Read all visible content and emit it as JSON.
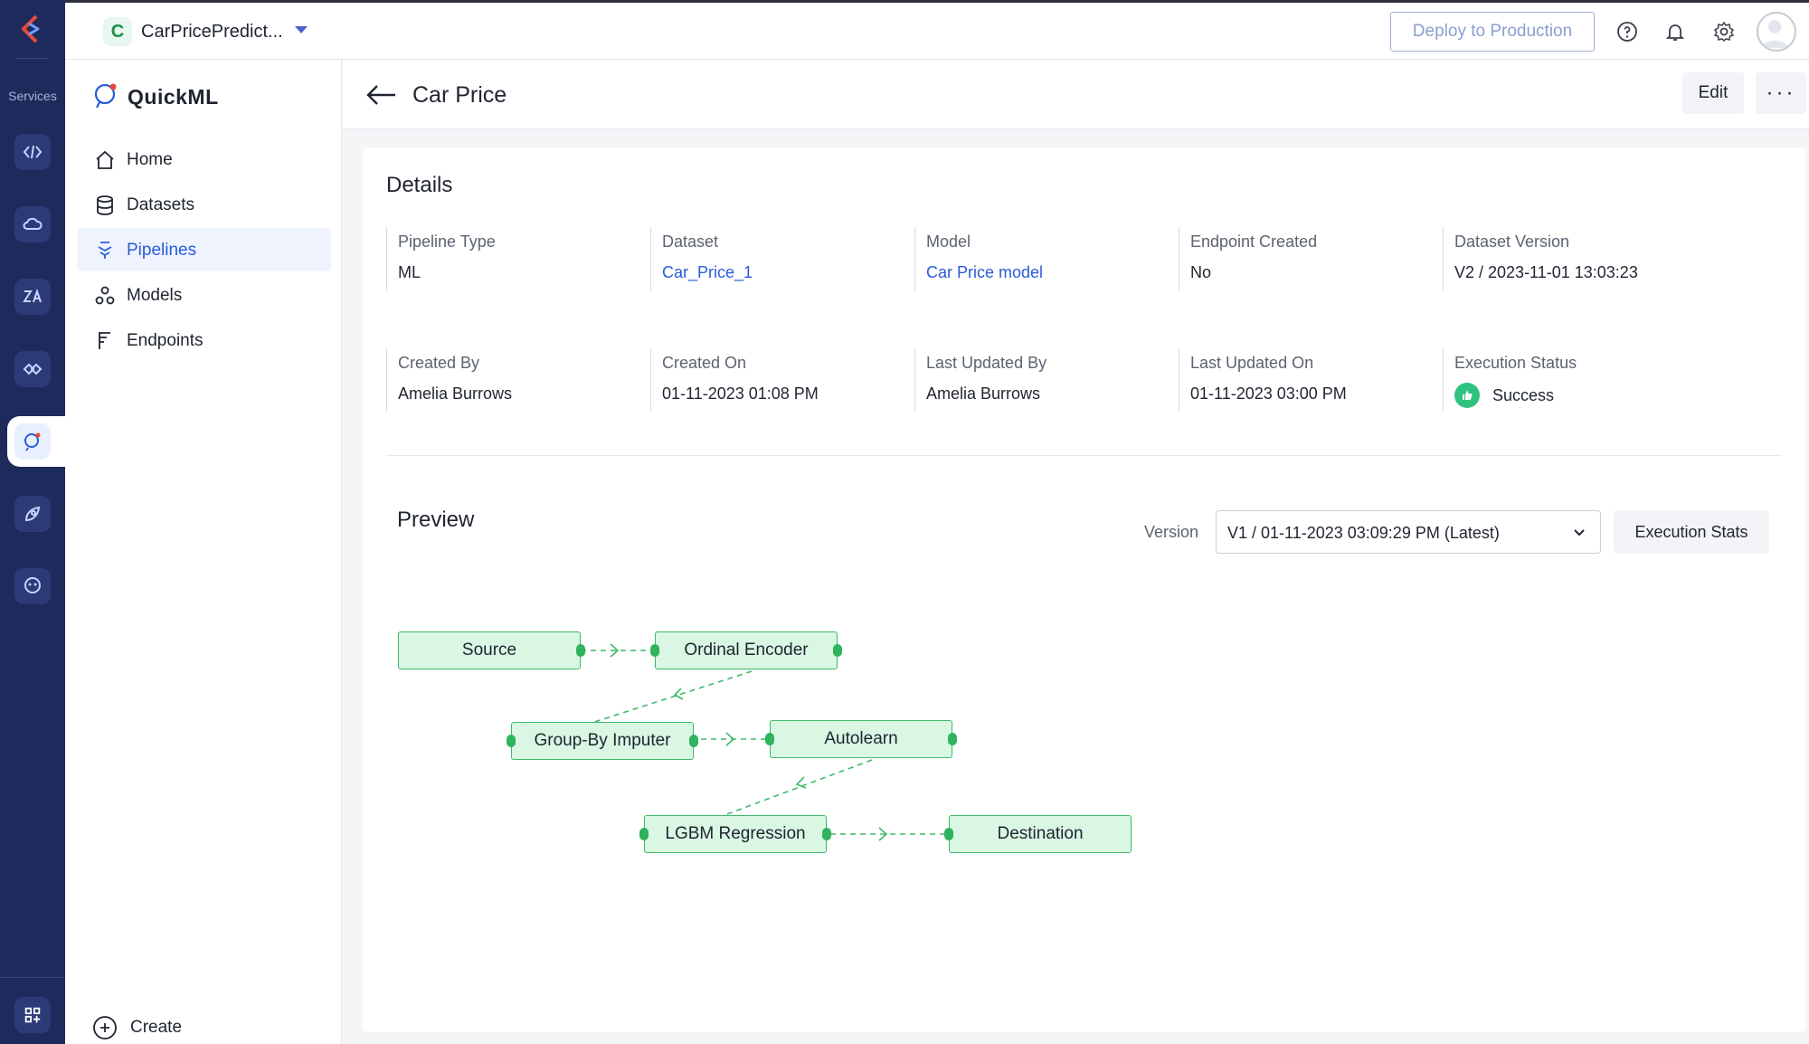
{
  "rail": {
    "services_label": "Services"
  },
  "topbar": {
    "project_initial": "C",
    "project_name": "CarPricePredict...",
    "deploy_label": "Deploy to Production"
  },
  "sidebar": {
    "app_name": "QuickML",
    "items": [
      {
        "label": "Home"
      },
      {
        "label": "Datasets"
      },
      {
        "label": "Pipelines"
      },
      {
        "label": "Models"
      },
      {
        "label": "Endpoints"
      }
    ],
    "create_label": "Create"
  },
  "header": {
    "title": "Car Price",
    "edit_label": "Edit",
    "more_label": "···"
  },
  "details": {
    "title": "Details",
    "fields": [
      {
        "label": "Pipeline Type",
        "value": "ML"
      },
      {
        "label": "Dataset",
        "value": "Car_Price_1"
      },
      {
        "label": "Model",
        "value": "Car Price model"
      },
      {
        "label": "Endpoint Created",
        "value": "No"
      },
      {
        "label": "Dataset Version",
        "value": "V2 / 2023-11-01 13:03:23"
      },
      {
        "label": "Created By",
        "value": "Amelia Burrows"
      },
      {
        "label": "Created On",
        "value": "01-11-2023 01:08 PM"
      },
      {
        "label": "Last Updated By",
        "value": "Amelia Burrows"
      },
      {
        "label": "Last Updated On",
        "value": "01-11-2023 03:00 PM"
      },
      {
        "label": "Execution Status",
        "value": "Success"
      }
    ]
  },
  "preview": {
    "title": "Preview",
    "version_label": "Version",
    "version_value": "V1 / 01-11-2023 03:09:29 PM (Latest)",
    "exec_stats_label": "Execution Stats",
    "nodes": [
      {
        "label": "Source"
      },
      {
        "label": "Ordinal Encoder"
      },
      {
        "label": "Group-By Imputer"
      },
      {
        "label": "Autolearn"
      },
      {
        "label": "LGBM Regression"
      },
      {
        "label": "Destination"
      }
    ]
  },
  "colors": {
    "rail_bg": "#1f2a5c",
    "accent_blue": "#2a5bd7",
    "node_fill": "#d9f7e3",
    "node_border": "#3fb96a",
    "success": "#2ec27e"
  }
}
